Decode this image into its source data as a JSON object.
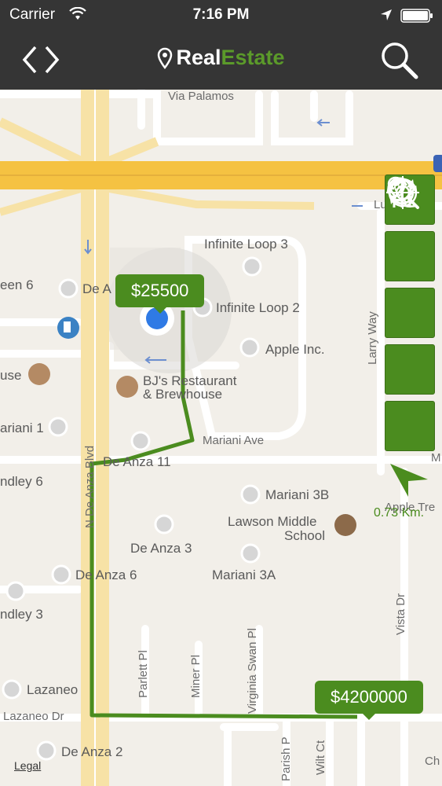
{
  "status_bar": {
    "carrier": "Carrier",
    "time": "7:16 PM"
  },
  "header": {
    "brand_primary": "Real",
    "brand_accent": "Estate",
    "back_forward_icon": "chevrons-left-right-icon",
    "search_icon": "search-icon",
    "brand_icon": "map-pin-icon"
  },
  "map": {
    "roads": {
      "via_palamos": "Via Palamos",
      "mariani_ave": "Mariani Ave",
      "n_de_anza": "N De Anza Blvd",
      "larry_way": "Larry Way",
      "lazaneo_dr": "Lazaneo Dr",
      "vista_dr": "Vista Dr",
      "parlett_pl": "Parlett Pl",
      "miner_pl": "Miner Pl",
      "virginia_swan_pl": "Virginia Swan Pl",
      "parish_pl": "Parish P",
      "wilt_ct": "Wilt Ct",
      "apple_tree": "Apple Tre",
      "lu": "Lu",
      "m": "M",
      "ch": "Ch"
    },
    "pois": {
      "infinite_loop_3": "Infinite Loop 3",
      "infinite_loop_2": "Infinite Loop 2",
      "apple_inc": "Apple Inc.",
      "de_anza_edge": "De A",
      "een_6": "een 6",
      "use": "use",
      "bjs_line1": "BJ's Restaurant",
      "bjs_line2": "& Brewhouse",
      "ariani_1": "ariani 1",
      "de_anza_11": "De Anza 11",
      "ndley_6": "ndley 6",
      "mariani_3b": "Mariani 3B",
      "lawson_line1": "Lawson Middle",
      "lawson_line2": "School",
      "de_anza_3": "De Anza 3",
      "de_anza_6": "De Anza 6",
      "mariani_3a": "Mariani 3A",
      "ndley_3": "ndley 3",
      "lazaneo": "Lazaneo",
      "de_anza_2": "De Anza 2"
    },
    "price_markers": [
      "$25500",
      "$4200000"
    ],
    "distance": "0.73 Km.",
    "legal": "Legal",
    "route_color": "#4b8c1f",
    "highway_color": "#f5c242"
  },
  "tools": [
    {
      "name": "route-tool-button",
      "icon": "route-pin-icon"
    },
    {
      "name": "refresh-tool-button",
      "icon": "refresh-icon"
    },
    {
      "name": "directions-tool-button",
      "icon": "split-arrows-icon"
    },
    {
      "name": "locate-tool-button",
      "icon": "crosshair-icon"
    },
    {
      "name": "zoom-search-tool-button",
      "icon": "zoom-pin-icon"
    }
  ]
}
